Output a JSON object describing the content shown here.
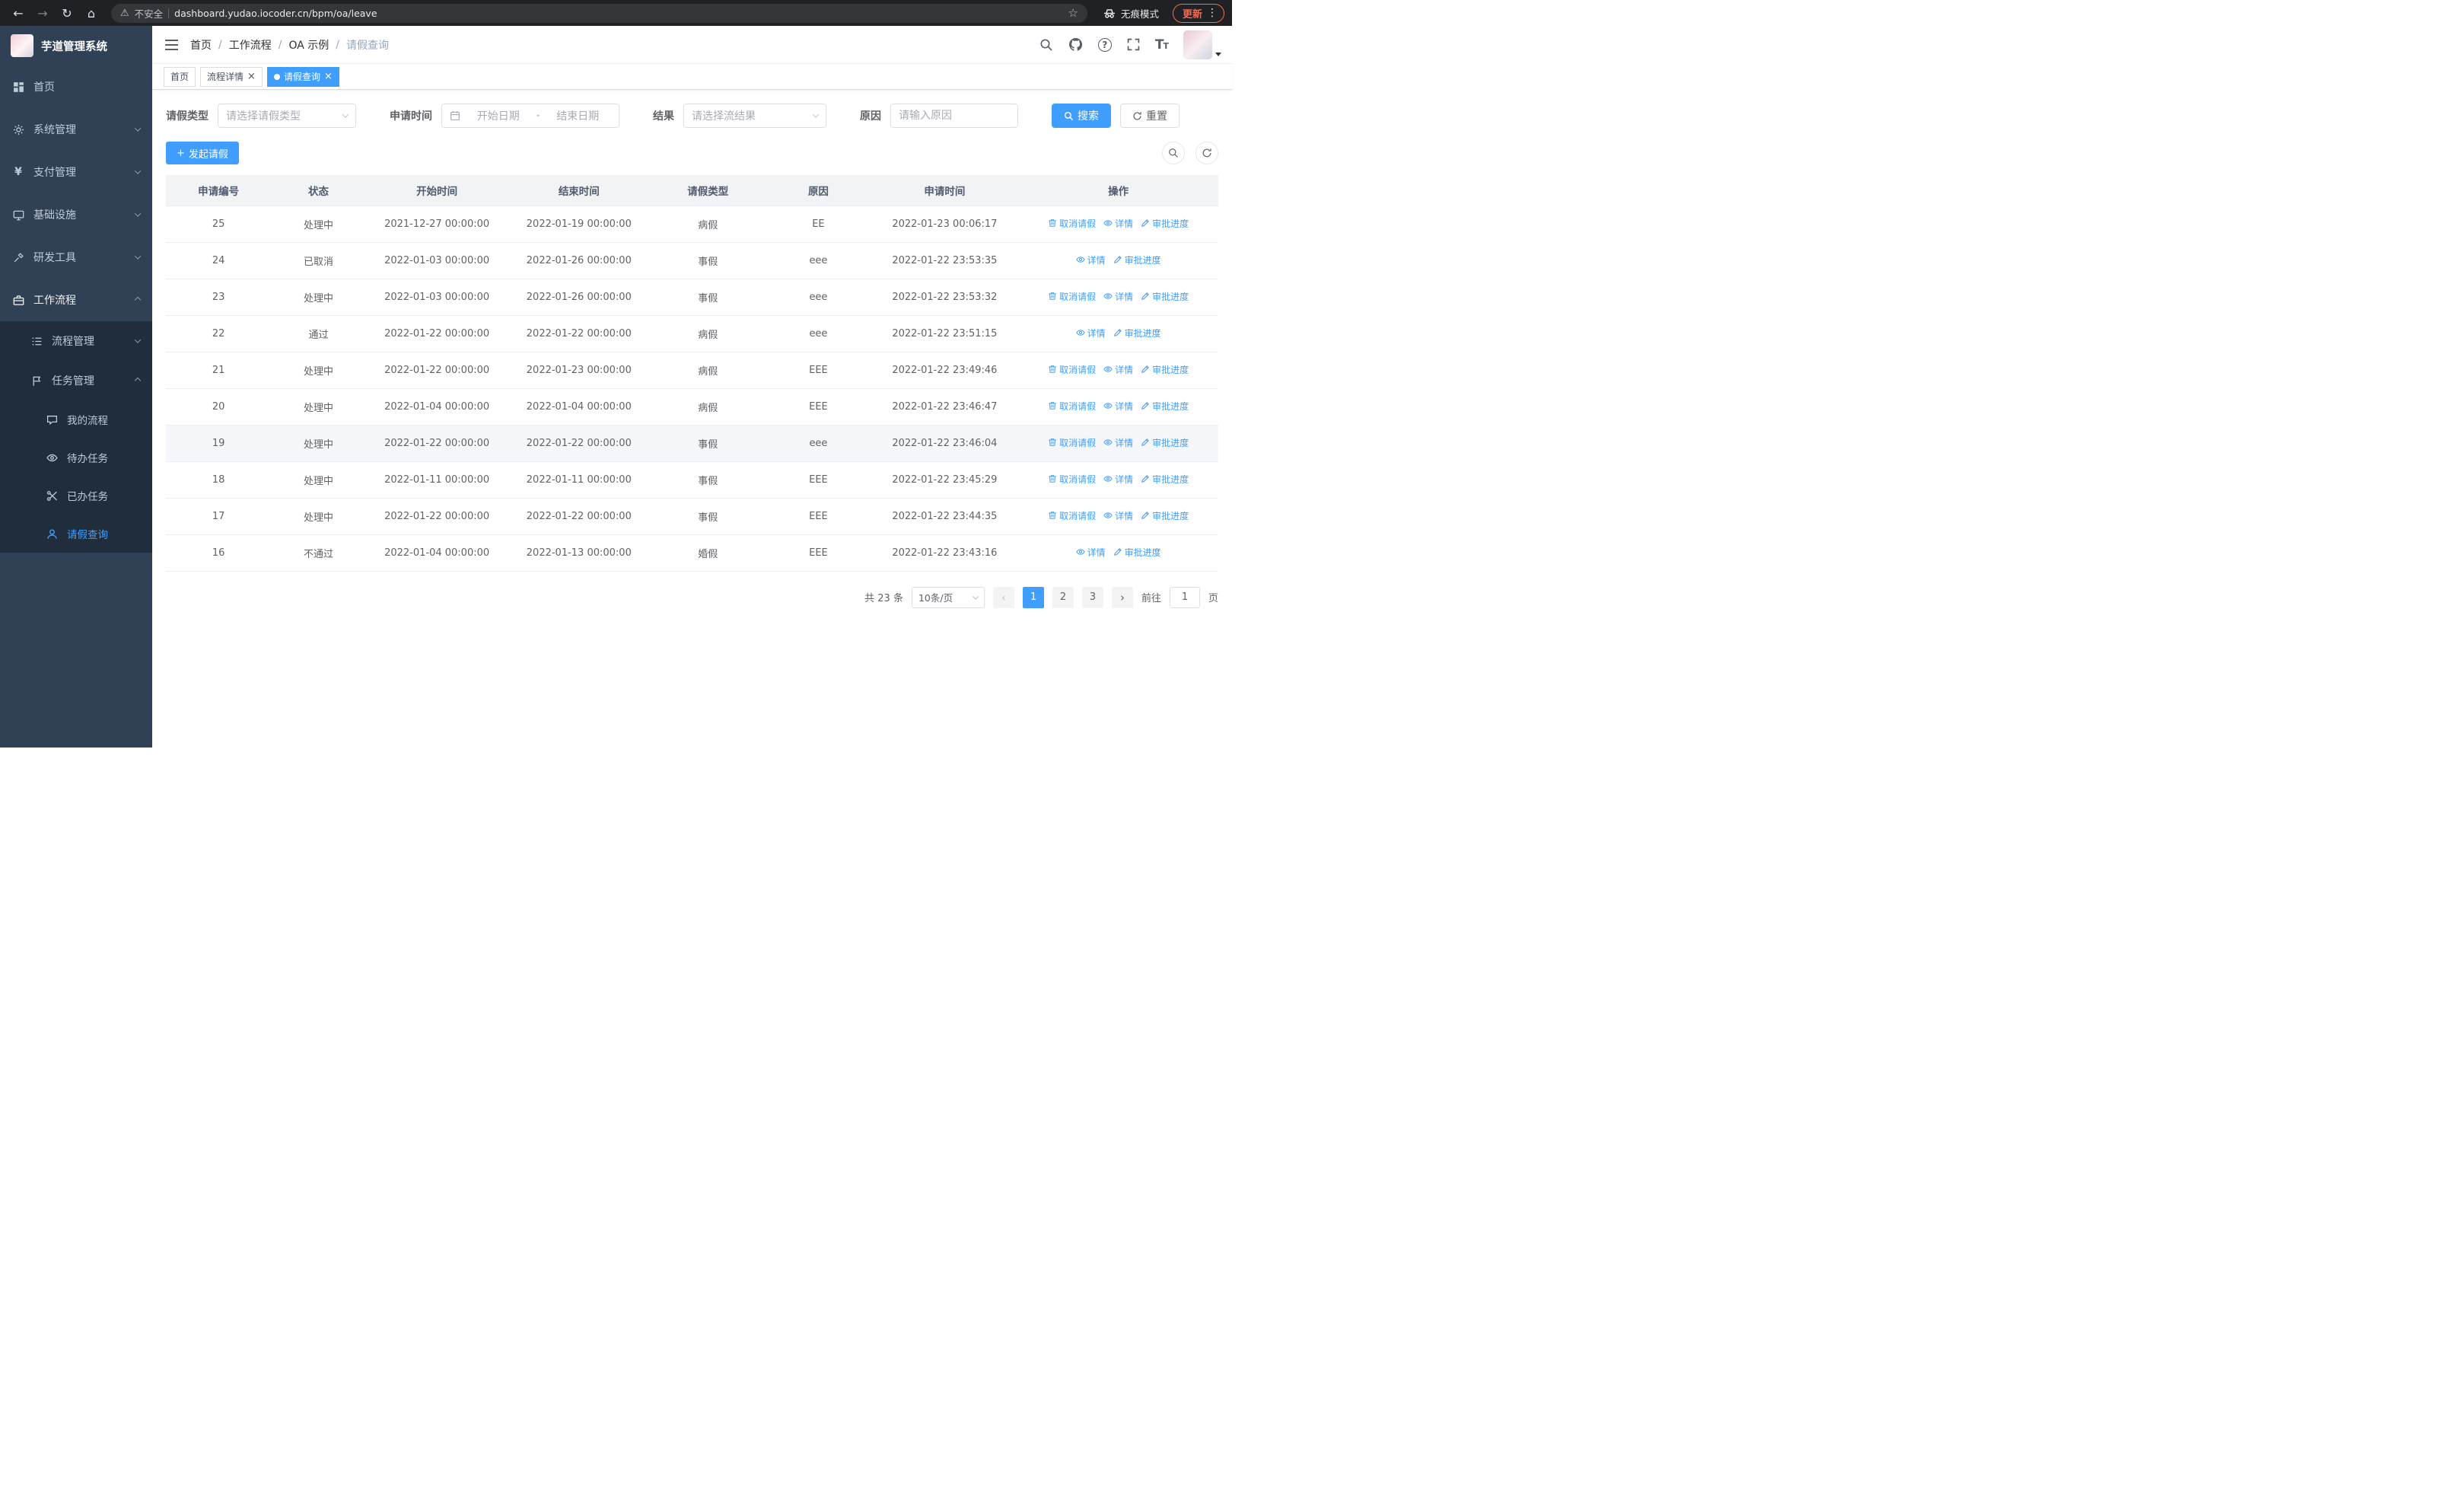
{
  "colors": {
    "accent": "#409eff",
    "sidebar_bg": "#304156",
    "sidebar_submenu_bg": "#1f2d3d",
    "update_red": "#f46a54"
  },
  "browser": {
    "security_label": "不安全",
    "url": "dashboard.yudao.iocoder.cn/bpm/oa/leave",
    "incognito_label": "无痕模式",
    "update_label": "更新"
  },
  "sidebar": {
    "logo_title": "芋道管理系统",
    "items": [
      "首页",
      "系统管理",
      "支付管理",
      "基础设施",
      "研发工具",
      "工作流程"
    ],
    "workflow_children": [
      "流程管理",
      "任务管理"
    ],
    "task_children": [
      "我的流程",
      "待办任务",
      "已办任务",
      "请假查询"
    ]
  },
  "breadcrumb": {
    "items": [
      "首页",
      "工作流程",
      "OA 示例",
      "请假查询"
    ],
    "separator": "/"
  },
  "tabs": [
    {
      "label": "首页",
      "closable": false,
      "active": false
    },
    {
      "label": "流程详情",
      "closable": true,
      "active": false
    },
    {
      "label": "请假查询",
      "closable": true,
      "active": true
    }
  ],
  "filters": {
    "type_label": "请假类型",
    "type_placeholder": "请选择请假类型",
    "time_label": "申请时间",
    "start_placeholder": "开始日期",
    "range_separator": "-",
    "end_placeholder": "结束日期",
    "result_label": "结果",
    "result_placeholder": "请选择流结果",
    "reason_label": "原因",
    "reason_placeholder": "请输入原因",
    "search_label": "搜索",
    "reset_label": "重置"
  },
  "toolbar": {
    "create_label": "发起请假"
  },
  "table": {
    "headers": [
      "申请编号",
      "状态",
      "开始时间",
      "结束时间",
      "请假类型",
      "原因",
      "申请时间",
      "操作"
    ],
    "rows": [
      {
        "id": "25",
        "status": "处理中",
        "start": "2021-12-27 00:00:00",
        "end": "2022-01-19 00:00:00",
        "type": "病假",
        "reason": "EE",
        "applied": "2022-01-23 00:06:17",
        "highlighted": false,
        "actions": [
          {
            "label": "取消请假",
            "icon": "delete"
          },
          {
            "label": "详情",
            "icon": "view"
          },
          {
            "label": "审批进度",
            "icon": "edit"
          }
        ]
      },
      {
        "id": "24",
        "status": "已取消",
        "start": "2022-01-03 00:00:00",
        "end": "2022-01-26 00:00:00",
        "type": "事假",
        "reason": "eee",
        "applied": "2022-01-22 23:53:35",
        "highlighted": false,
        "actions": [
          {
            "label": "详情",
            "icon": "view"
          },
          {
            "label": "审批进度",
            "icon": "edit"
          }
        ]
      },
      {
        "id": "23",
        "status": "处理中",
        "start": "2022-01-03 00:00:00",
        "end": "2022-01-26 00:00:00",
        "type": "事假",
        "reason": "eee",
        "applied": "2022-01-22 23:53:32",
        "highlighted": false,
        "actions": [
          {
            "label": "取消请假",
            "icon": "delete"
          },
          {
            "label": "详情",
            "icon": "view"
          },
          {
            "label": "审批进度",
            "icon": "edit"
          }
        ]
      },
      {
        "id": "22",
        "status": "通过",
        "start": "2022-01-22 00:00:00",
        "end": "2022-01-22 00:00:00",
        "type": "病假",
        "reason": "eee",
        "applied": "2022-01-22 23:51:15",
        "highlighted": false,
        "actions": [
          {
            "label": "详情",
            "icon": "view"
          },
          {
            "label": "审批进度",
            "icon": "edit"
          }
        ]
      },
      {
        "id": "21",
        "status": "处理中",
        "start": "2022-01-22 00:00:00",
        "end": "2022-01-23 00:00:00",
        "type": "病假",
        "reason": "EEE",
        "applied": "2022-01-22 23:49:46",
        "highlighted": false,
        "actions": [
          {
            "label": "取消请假",
            "icon": "delete"
          },
          {
            "label": "详情",
            "icon": "view"
          },
          {
            "label": "审批进度",
            "icon": "edit"
          }
        ]
      },
      {
        "id": "20",
        "status": "处理中",
        "start": "2022-01-04 00:00:00",
        "end": "2022-01-04 00:00:00",
        "type": "病假",
        "reason": "EEE",
        "applied": "2022-01-22 23:46:47",
        "highlighted": false,
        "actions": [
          {
            "label": "取消请假",
            "icon": "delete"
          },
          {
            "label": "详情",
            "icon": "view"
          },
          {
            "label": "审批进度",
            "icon": "edit"
          }
        ]
      },
      {
        "id": "19",
        "status": "处理中",
        "start": "2022-01-22 00:00:00",
        "end": "2022-01-22 00:00:00",
        "type": "事假",
        "reason": "eee",
        "applied": "2022-01-22 23:46:04",
        "highlighted": true,
        "actions": [
          {
            "label": "取消请假",
            "icon": "delete"
          },
          {
            "label": "详情",
            "icon": "view"
          },
          {
            "label": "审批进度",
            "icon": "edit"
          }
        ]
      },
      {
        "id": "18",
        "status": "处理中",
        "start": "2022-01-11 00:00:00",
        "end": "2022-01-11 00:00:00",
        "type": "事假",
        "reason": "EEE",
        "applied": "2022-01-22 23:45:29",
        "highlighted": false,
        "actions": [
          {
            "label": "取消请假",
            "icon": "delete"
          },
          {
            "label": "详情",
            "icon": "view"
          },
          {
            "label": "审批进度",
            "icon": "edit"
          }
        ]
      },
      {
        "id": "17",
        "status": "处理中",
        "start": "2022-01-22 00:00:00",
        "end": "2022-01-22 00:00:00",
        "type": "事假",
        "reason": "EEE",
        "applied": "2022-01-22 23:44:35",
        "highlighted": false,
        "actions": [
          {
            "label": "取消请假",
            "icon": "delete"
          },
          {
            "label": "详情",
            "icon": "view"
          },
          {
            "label": "审批进度",
            "icon": "edit"
          }
        ]
      },
      {
        "id": "16",
        "status": "不通过",
        "start": "2022-01-04 00:00:00",
        "end": "2022-01-13 00:00:00",
        "type": "婚假",
        "reason": "EEE",
        "applied": "2022-01-22 23:43:16",
        "highlighted": false,
        "actions": [
          {
            "label": "详情",
            "icon": "view"
          },
          {
            "label": "审批进度",
            "icon": "edit"
          }
        ]
      }
    ]
  },
  "pagination": {
    "total": "共 23 条",
    "page_size": "10条/页",
    "pages": [
      "1",
      "2",
      "3"
    ],
    "active_page": "1",
    "goto_label": "前往",
    "goto_value": "1",
    "page_unit": "页"
  }
}
